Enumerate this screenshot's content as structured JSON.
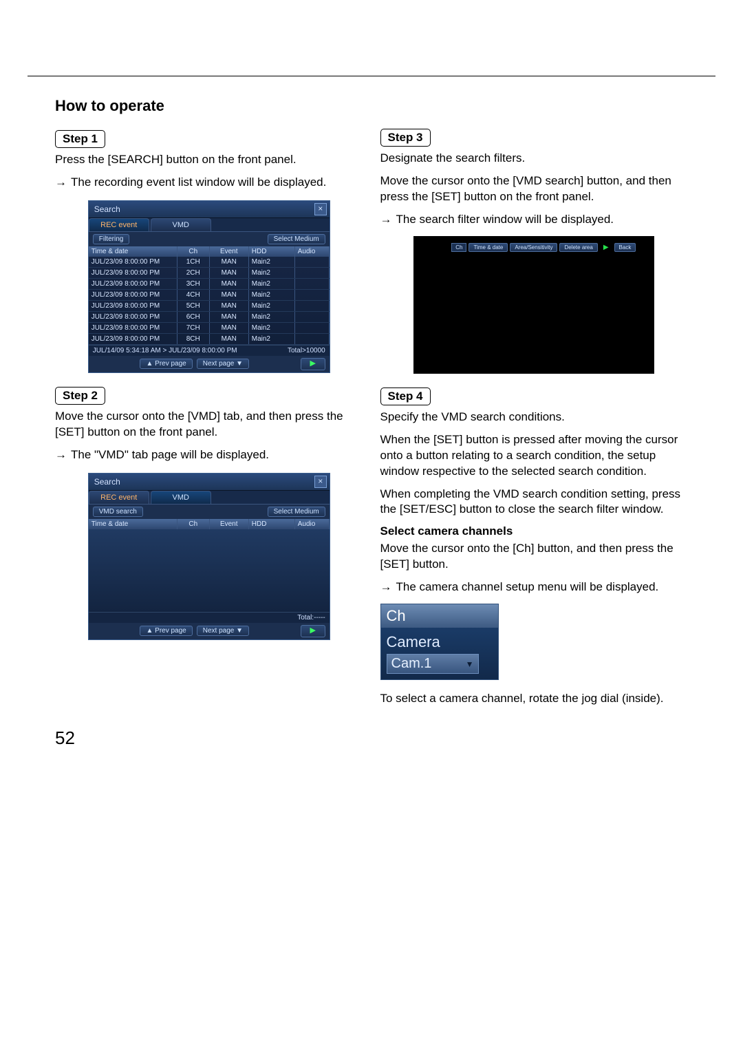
{
  "page_number": "52",
  "heading": "How to operate",
  "steps": {
    "s1": {
      "label": "Step 1",
      "p1": "Press the [SEARCH] button on the front panel.",
      "p2": "The recording event list window will be displayed."
    },
    "s2": {
      "label": "Step 2",
      "p1": "Move the cursor onto the [VMD] tab, and then press the [SET] button on the front panel.",
      "p2": "The \"VMD\" tab page will be displayed."
    },
    "s3": {
      "label": "Step 3",
      "p1": "Designate the search filters.",
      "p2": "Move the cursor onto the [VMD search] button, and then press the [SET] button on the front panel.",
      "p3": "The search filter window will be displayed."
    },
    "s4": {
      "label": "Step 4",
      "p1": "Specify the VMD search conditions.",
      "p2": "When the [SET] button is pressed after moving the cursor onto a button relating to a search condition, the setup window respective to the selected search condition.",
      "p3": "When completing the VMD search condition setting, press the [SET/ESC] button to close the search filter window.",
      "sub": "Select camera channels",
      "p4": "Move the cursor onto the [Ch] button, and then press the [SET] button.",
      "p5": "The camera channel setup menu will be displayed.",
      "p6": "To select a camera channel, rotate the jog dial (inside)."
    }
  },
  "search_window": {
    "title": "Search",
    "tabs": {
      "rec": "REC event",
      "vmd": "VMD"
    },
    "filtering_btn": "Filtering",
    "vmd_search_btn": "VMD search",
    "select_medium": "Select Medium",
    "headers": {
      "td": "Time & date",
      "ch": "Ch",
      "ev": "Event",
      "hd": "HDD",
      "au": "Audio"
    },
    "rows": [
      {
        "td": "JUL/23/09  8:00:00 PM",
        "ch": "1CH",
        "ev": "MAN",
        "hd": "Main2",
        "au": ""
      },
      {
        "td": "JUL/23/09  8:00:00 PM",
        "ch": "2CH",
        "ev": "MAN",
        "hd": "Main2",
        "au": ""
      },
      {
        "td": "JUL/23/09  8:00:00 PM",
        "ch": "3CH",
        "ev": "MAN",
        "hd": "Main2",
        "au": ""
      },
      {
        "td": "JUL/23/09  8:00:00 PM",
        "ch": "4CH",
        "ev": "MAN",
        "hd": "Main2",
        "au": ""
      },
      {
        "td": "JUL/23/09  8:00:00 PM",
        "ch": "5CH",
        "ev": "MAN",
        "hd": "Main2",
        "au": ""
      },
      {
        "td": "JUL/23/09  8:00:00 PM",
        "ch": "6CH",
        "ev": "MAN",
        "hd": "Main2",
        "au": ""
      },
      {
        "td": "JUL/23/09  8:00:00 PM",
        "ch": "7CH",
        "ev": "MAN",
        "hd": "Main2",
        "au": ""
      },
      {
        "td": "JUL/23/09  8:00:00 PM",
        "ch": "8CH",
        "ev": "MAN",
        "hd": "Main2",
        "au": ""
      }
    ],
    "status_range": "JUL/14/09  5:34:18 AM > JUL/23/09  8:00:00 PM",
    "status_total": "Total>10000",
    "status_total_empty": "Total:-----",
    "prev": "▲ Prev page",
    "next": "Next page ▼"
  },
  "filter_window": {
    "ch": "Ch",
    "btns": [
      "Time & date",
      "Area/Sensitivity",
      "Delete area"
    ],
    "back": "Back"
  },
  "ch_popup": {
    "title": "Ch",
    "label": "Camera",
    "value": "Cam.1"
  }
}
